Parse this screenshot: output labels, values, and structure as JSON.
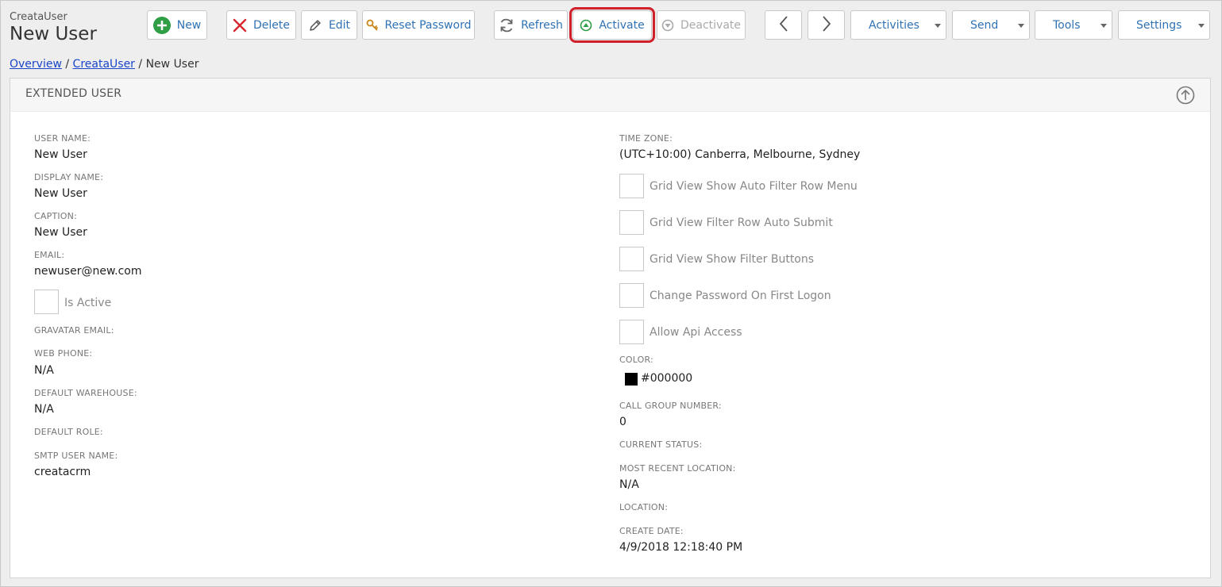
{
  "header": {
    "app_name": "CreataUser",
    "record_title": "New User"
  },
  "toolbar": {
    "new_label": "New",
    "delete_label": "Delete",
    "edit_label": "Edit",
    "reset_password_label": "Reset Password",
    "refresh_label": "Refresh",
    "activate_label": "Activate",
    "deactivate_label": "Deactivate",
    "activities_label": "Activities",
    "send_label": "Send",
    "tools_label": "Tools",
    "settings_label": "Settings"
  },
  "breadcrumb": {
    "overview": "Overview",
    "sep1": "/",
    "creatauser": "CreataUser",
    "sep2": "/",
    "current": "New User"
  },
  "panel": {
    "title": "EXTENDED USER",
    "left": {
      "user_name_label": "USER NAME:",
      "user_name": "New User",
      "display_name_label": "DISPLAY NAME:",
      "display_name": "New User",
      "caption_label": "CAPTION:",
      "caption": "New User",
      "email_label": "EMAIL:",
      "email": "newuser@new.com",
      "is_active_label": "Is Active",
      "is_active_checked": false,
      "gravatar_email_label": "GRAVATAR EMAIL:",
      "web_phone_label": "WEB PHONE:",
      "web_phone": "N/A",
      "default_warehouse_label": "DEFAULT WAREHOUSE:",
      "default_warehouse": "N/A",
      "default_role_label": "DEFAULT ROLE:",
      "smtp_user_name_label": "SMTP USER NAME:",
      "smtp_user_name": "creatacrm"
    },
    "right": {
      "time_zone_label": "TIME ZONE:",
      "time_zone": "(UTC+10:00) Canberra, Melbourne, Sydney",
      "grid_auto_filter_menu_label": "Grid View Show Auto Filter Row Menu",
      "grid_filter_auto_submit_label": "Grid View Filter Row Auto Submit",
      "grid_show_filter_buttons_label": "Grid View Show Filter Buttons",
      "change_password_label": "Change Password On First Logon",
      "allow_api_access_label": "Allow Api Access",
      "color_label": "COLOR:",
      "color_value": "#000000",
      "call_group_number_label": "CALL GROUP NUMBER:",
      "call_group_number": "0",
      "current_status_label": "CURRENT STATUS:",
      "most_recent_location_label": "MOST RECENT LOCATION:",
      "most_recent_location": "N/A",
      "location_label": "LOCATION:",
      "create_date_label": "CREATE DATE:",
      "create_date": "4/9/2018 12:18:40 PM"
    }
  },
  "colors": {
    "link": "#3072b4",
    "highlight": "#d0202a",
    "new_icon": "#2f9e44",
    "delete_icon": "#d9262e"
  },
  "icons": {
    "new": "plus-circle-icon",
    "delete": "x-icon",
    "edit": "pencil-icon",
    "reset_password": "key-icon",
    "refresh": "refresh-icon",
    "activate": "up-arrow-circle-icon",
    "deactivate": "down-arrow-circle-icon",
    "prev": "chevron-left-icon",
    "next": "chevron-right-icon",
    "collapse": "arrow-up-circle-icon"
  }
}
